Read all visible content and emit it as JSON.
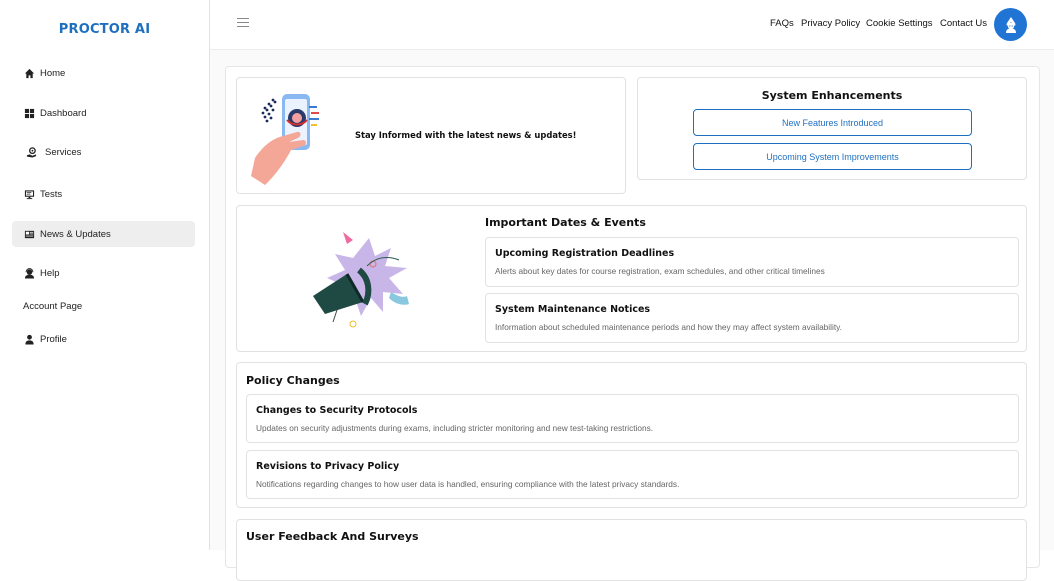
{
  "brand": "PROCTOR AI",
  "sidebar": {
    "items": [
      {
        "label": "Home",
        "icon": "home-icon"
      },
      {
        "label": "Dashboard",
        "icon": "grid-icon"
      },
      {
        "label": "Services",
        "icon": "services-icon"
      },
      {
        "label": "Tests",
        "icon": "monitor-icon"
      },
      {
        "label": "News & Updates",
        "icon": "newspaper-icon"
      },
      {
        "label": "Help",
        "icon": "support-icon"
      },
      {
        "label": "Account Page"
      },
      {
        "label": "Profile",
        "icon": "user-icon"
      }
    ]
  },
  "header": {
    "links": [
      "FAQs",
      "Privacy Policy",
      "Cookie Settings",
      "Contact Us"
    ]
  },
  "hero": {
    "text": "Stay Informed with the latest news & updates!"
  },
  "enhancements": {
    "title": "System Enhancements",
    "buttons": [
      "New Features Introduced",
      "Upcoming System Improvements"
    ]
  },
  "dates": {
    "title": "Important Dates & Events",
    "items": [
      {
        "title": "Upcoming Registration Deadlines",
        "desc": "Alerts about key dates for course registration, exam schedules, and other critical timelines"
      },
      {
        "title": "System Maintenance Notices",
        "desc": "Information about scheduled maintenance periods and how they may affect system availability."
      }
    ]
  },
  "policy": {
    "title": "Policy Changes",
    "items": [
      {
        "title": "Changes to Security Protocols",
        "desc": "Updates on security adjustments during exams, including stricter monitoring and new test-taking restrictions."
      },
      {
        "title": "Revisions to Privacy Policy",
        "desc": "Notifications regarding changes to how user data is handled, ensuring compliance with the latest privacy standards."
      }
    ]
  },
  "feedback": {
    "title": "User Feedback And Surveys"
  },
  "colors": {
    "brand": "#1e6fc0",
    "accent": "#1f74d4"
  }
}
